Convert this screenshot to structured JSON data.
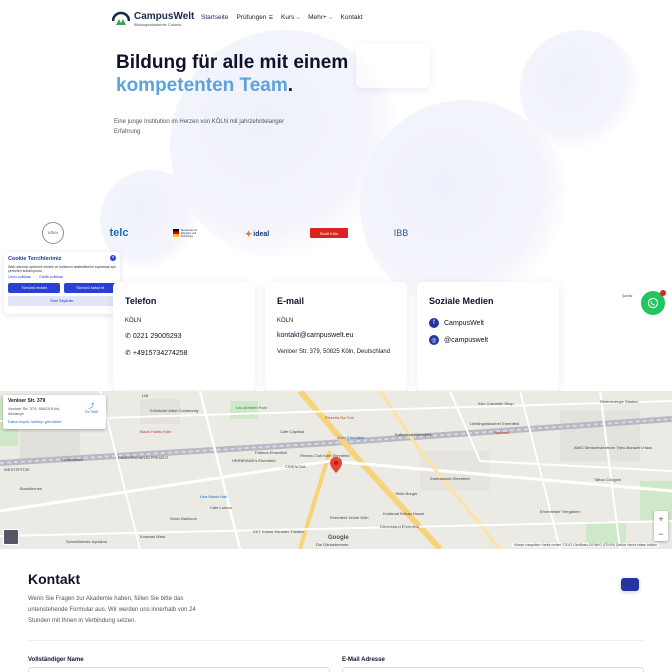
{
  "header": {
    "logo_name": "CampusWelt",
    "logo_sub": "Bildungsakademie Colonia",
    "nav": [
      {
        "label": "Startseite"
      },
      {
        "label": "Prüfungen"
      },
      {
        "label": "Kurs"
      },
      {
        "label": "Mehr+"
      },
      {
        "label": "Kontakt"
      }
    ]
  },
  "hero": {
    "title_line1": "Bildung für alle mit einem",
    "title_accent": "kompetenten Team",
    "title_dot": ".",
    "subtitle": "Eine junge Institution im Herzen von KÖLN mit jahrzehntelanger Erfahrung"
  },
  "partners": [
    {
      "label": "KÖLN"
    },
    {
      "label": "telc"
    },
    {
      "label": "Bundesamt für Migration und Flüchtlinge"
    },
    {
      "label": "ideal"
    },
    {
      "label": "Stadt Köln"
    },
    {
      "label": "IBB"
    }
  ],
  "cookie": {
    "title": "Cookie Tercihlerimiz",
    "text": "Web sitemizi optimize etmek ve kullanım istatistiklerini toplamak için çerezleri kullanıyoruz.",
    "link1": "Çerez politikası",
    "link2": "Gizlilik politikası",
    "btn_reject": "Tümünü reddet",
    "btn_accept": "Tümünü kabul et",
    "btn_settings": "Özel Seçimler"
  },
  "cards": {
    "phone": {
      "title": "Telefon",
      "city": "KÖLN",
      "phone": "0221 29005293",
      "mobile": "+4915734274258"
    },
    "email": {
      "title": "E-mail",
      "city": "KÖLN",
      "email": "kontakt@campuswelt.eu",
      "address": "Venloer Str. 379, 50825 Köln, Deutschland"
    },
    "social": {
      "title": "Soziale Medien",
      "facebook": "CampusWelt",
      "instagram": "@campuswelt"
    }
  },
  "map": {
    "info_title": "Venloer Str. 379",
    "info_address": "Venloer Str. 379, 50825 Köln, Almanya",
    "info_link": "Daha büyük haritayı görüntüle",
    "route_label": "Yol Tarifi",
    "labels": [
      {
        "text": "Lidl"
      },
      {
        "text": "Kölnische Artist Community"
      },
      {
        "text": "Leo Arnhem Park"
      },
      {
        "text": "Pizzeria Da Toni"
      },
      {
        "text": "Köln Ehrenfeld"
      },
      {
        "text": "Kaffeebud Ehrenfeld"
      },
      {
        "text": "Black Hotels Köln"
      },
      {
        "text": "Cafe Capitola"
      },
      {
        "text": "HERBRAND's Ehrenfeld"
      },
      {
        "text": "Fatteria Ehrenfeld"
      },
      {
        "text": "CINENOVA"
      },
      {
        "text": "Live Music Hall"
      },
      {
        "text": "Cafe Lumos"
      },
      {
        "text": "Ehrenfeld Zeche Köln"
      },
      {
        "text": "Afro Cosmetic Shop"
      },
      {
        "text": "Lieblingsbäckerei Ehrenfeld"
      },
      {
        "text": "Hammer"
      },
      {
        "text": "Yildiz Burger"
      },
      {
        "text": "Kudamat Kebap House"
      },
      {
        "text": "Dönerstand Ehrenfeld"
      },
      {
        "text": "AWO Seniorenzentrum Theo-Burauen-Haus"
      },
      {
        "text": "Tattoo Cologne"
      },
      {
        "text": "Kontrast Werk"
      },
      {
        "text": "KKT Kölner Künstler Theater"
      },
      {
        "text": "Die Gänsebrenner"
      },
      {
        "text": "Sonic Ballroom"
      },
      {
        "text": "Schnellimbiss Kyriakos"
      },
      {
        "text": "PANDORA NEUN FREIZEIT"
      },
      {
        "text": "WESTSPITZE"
      },
      {
        "text": "Lindenwerk"
      },
      {
        "text": "Fitness Club Köln Ehrenfeld"
      },
      {
        "text": "Ehrenfelder Tiergarten"
      },
      {
        "text": "Rheinenergie Stadion"
      },
      {
        "text": "Zweiradwelt Ehrenfeld"
      },
      {
        "text": "Bunzkirchen"
      }
    ],
    "footer": "Klavye kısayolları   Harita verileri ©2023 GeoBasis-DE/BKG (©2009)   Şartlar   Harita hatası bildirin",
    "google": "Google"
  },
  "contact": {
    "title": "Kontakt",
    "text": "Wenn Sie Fragen zur Akademie haben, füllen Sie bitte das untenstehende Formular aus. Wir werden uns innerhalb von 24 Stunden mit Ihnen in Verbindung setzen.",
    "field_name": "Vollständiger Name",
    "field_email": "E-Mail Adresse"
  },
  "colors": {
    "accent": "#5aa3de",
    "brand": "#2436a0",
    "whatsapp": "#22c55e"
  }
}
